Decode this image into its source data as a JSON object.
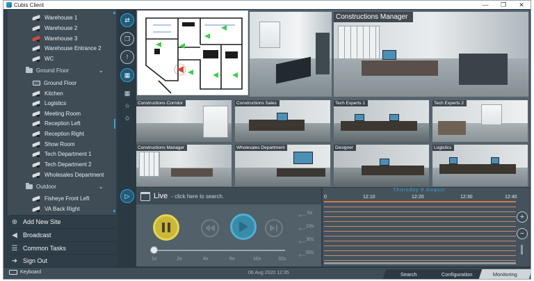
{
  "window": {
    "title": "Cubis Client",
    "minimize": "—",
    "maximize": "❐",
    "close": "✕"
  },
  "sidebar": {
    "items_top": [
      {
        "label": "Warehouse 1",
        "alert": false
      },
      {
        "label": "Warehouse 2",
        "alert": false
      },
      {
        "label": "Warehouse 3",
        "alert": true
      },
      {
        "label": "Warehouse Entrance 2",
        "alert": false
      },
      {
        "label": "WC",
        "alert": false
      }
    ],
    "group_ground": {
      "label": "Ground Floor",
      "chevron": "⌄"
    },
    "items_ground": [
      {
        "label": "Ground Floor"
      },
      {
        "label": "Kitchen"
      },
      {
        "label": "Logistics"
      },
      {
        "label": "Meeting Room"
      },
      {
        "label": "Reception Left"
      },
      {
        "label": "Reception Right"
      },
      {
        "label": "Show Room"
      },
      {
        "label": "Tech Department 1"
      },
      {
        "label": "Tech Department 2"
      },
      {
        "label": "Wholesales Department"
      }
    ],
    "group_outdoor": {
      "label": "Outdoor",
      "chevron": "⌄"
    },
    "items_outdoor": [
      {
        "label": "Fisheye Front Left"
      },
      {
        "label": "VA Back Right"
      }
    ]
  },
  "menu": {
    "add_site": "Add New Site",
    "broadcast": "Broadcast",
    "common_tasks": "Common Tasks",
    "sign_out": "Sign Out"
  },
  "icons": {
    "add_site": "globe-plus-icon",
    "broadcast": "megaphone-icon",
    "common_tasks": "hamburger-icon",
    "sign_out": "sign-out-icon"
  },
  "cameras": {
    "main": "Constructions Manager",
    "row2": [
      "Constructions Corridor",
      "Constructions Sales",
      "Tech Experts 1",
      "Tech Experts 2"
    ],
    "row3": [
      "Constructions Manager",
      "Wholesales Department",
      "Designer",
      "Logistics"
    ]
  },
  "playback": {
    "live": "Live",
    "hint": "- click here to search.",
    "speeds_right": [
      "5s",
      "10s",
      "30s",
      "60s"
    ],
    "speeds_bottom": [
      "1x",
      "2x",
      "4x",
      "8x",
      "16x",
      "32x"
    ]
  },
  "timeline": {
    "date": "Thursday 6 August",
    "times": [
      "0",
      "12:10",
      "12:20",
      "12:30",
      "12:40"
    ],
    "zoom_in": "+",
    "zoom_out": "−"
  },
  "status": {
    "keyboard": "Keyboard",
    "datetime": "06 Aug 2020  12:35",
    "tabs": [
      "Search",
      "Configuration",
      "Monitoring"
    ],
    "active_tab": "Monitoring"
  },
  "colors": {
    "accent": "#3aa1d8",
    "background": "#2e3d47",
    "alert": "#d34a3a"
  }
}
